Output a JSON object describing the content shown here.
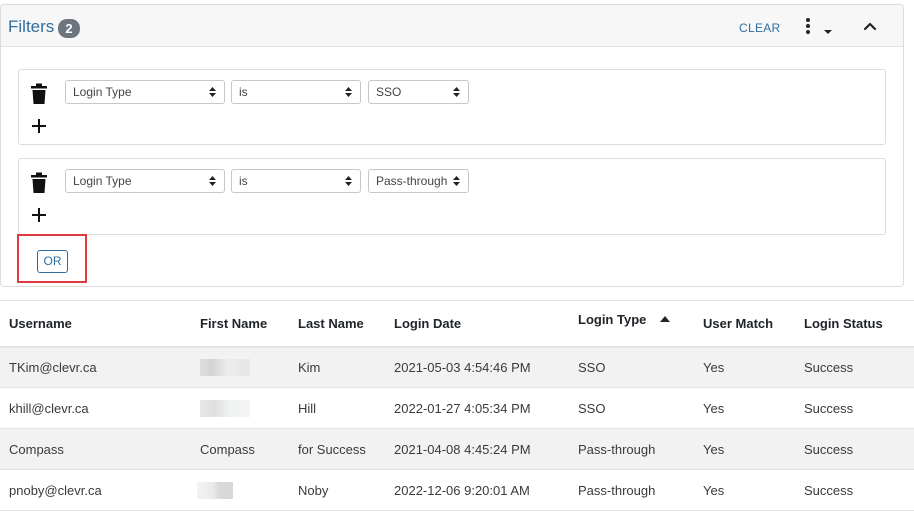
{
  "filters": {
    "title": "Filters",
    "count": "2",
    "clear_label": "CLEAR",
    "or_label": "OR",
    "groups": [
      {
        "field": "Login Type",
        "operator": "is",
        "value": "SSO"
      },
      {
        "field": "Login Type",
        "operator": "is",
        "value": "Pass-through"
      }
    ]
  },
  "table": {
    "columns": [
      "Username",
      "First Name",
      "Last Name",
      "Login Date",
      "Login Type",
      "User Match",
      "Login Status"
    ],
    "sorted_column": "Login Type",
    "sort_direction": "ascending",
    "rows": [
      {
        "username": "TKim@clevr.ca",
        "first_name": "",
        "last_name": "Kim",
        "login_date": "2021-05-03 4:54:46 PM",
        "login_type": "SSO",
        "user_match": "Yes",
        "login_status": "Success"
      },
      {
        "username": "khill@clevr.ca",
        "first_name": "",
        "last_name": "Hill",
        "login_date": "2022-01-27 4:05:34 PM",
        "login_type": "SSO",
        "user_match": "Yes",
        "login_status": "Success"
      },
      {
        "username": "Compass",
        "first_name": "Compass",
        "last_name": "for Success",
        "login_date": "2021-04-08 4:45:24 PM",
        "login_type": "Pass-through",
        "user_match": "Yes",
        "login_status": "Success"
      },
      {
        "username": "pnoby@clevr.ca",
        "first_name": "",
        "last_name": "Noby",
        "login_date": "2022-12-06 9:20:01 AM",
        "login_type": "Pass-through",
        "user_match": "Yes",
        "login_status": "Success"
      }
    ]
  },
  "icons": {
    "more": "kebab-icon",
    "collapse": "chevron-up-icon",
    "delete": "trash-icon",
    "add": "plus-icon",
    "select": "select-arrows-icon",
    "sort": "sort-ascending-icon"
  },
  "colors": {
    "accent": "#2f6f9f",
    "badge": "#6c757d",
    "highlight": "#e0393e",
    "stripe": "#f2f2f2"
  }
}
